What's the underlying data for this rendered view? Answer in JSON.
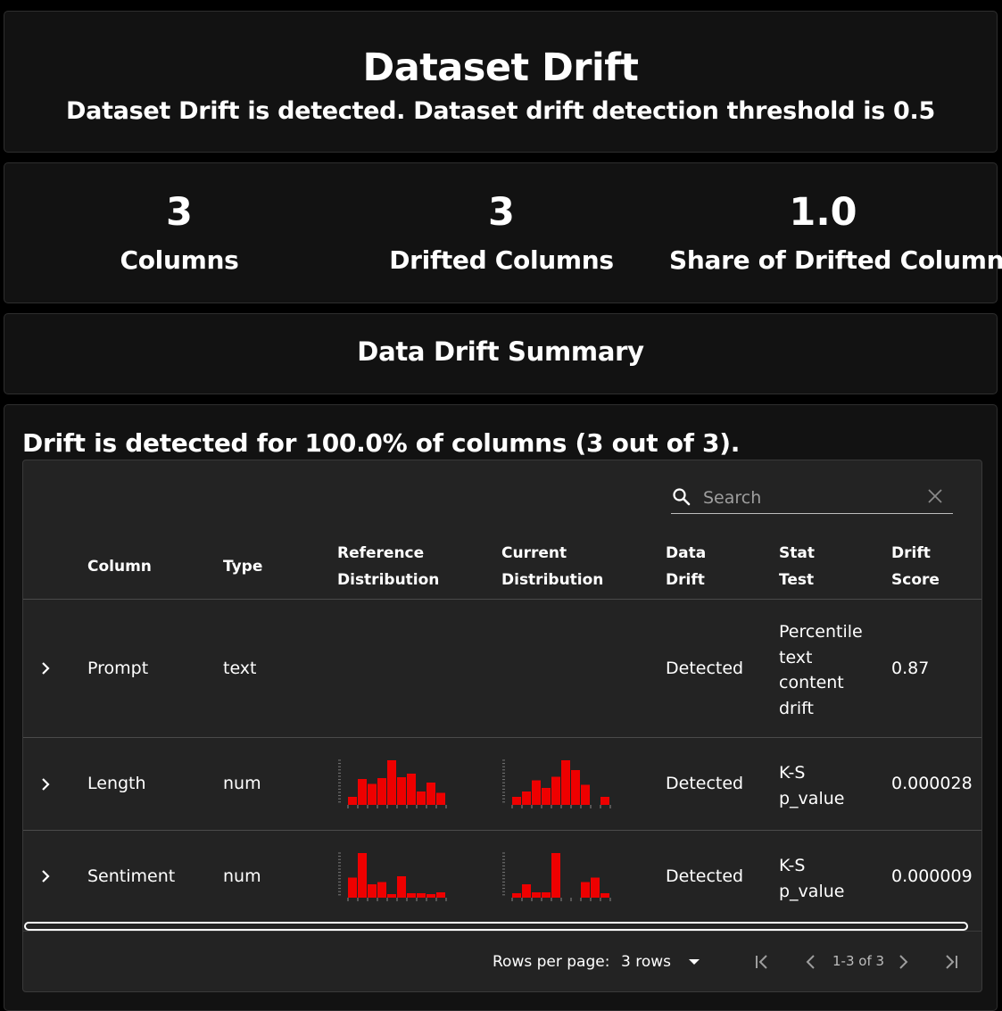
{
  "header": {
    "title": "Dataset Drift",
    "subtitle": "Dataset Drift is detected. Dataset drift detection threshold is 0.5"
  },
  "counters": [
    {
      "value": "3",
      "label": "Columns"
    },
    {
      "value": "3",
      "label": "Drifted Columns"
    },
    {
      "value": "1.0",
      "label": "Share of Drifted Columns"
    }
  ],
  "summary": {
    "title": "Data Drift Summary"
  },
  "table": {
    "message": "Drift is detected for 100.0% of columns (3 out of 3).",
    "search_placeholder": "Search",
    "headers": {
      "column": "Column",
      "type": "Type",
      "ref_1": "Reference",
      "ref_2": "Distribution",
      "cur_1": "Current",
      "cur_2": "Distribution",
      "drift_1": "Data",
      "drift_2": "Drift",
      "stat_1": "Stat",
      "stat_2": "Test",
      "score_1": "Drift",
      "score_2": "Score"
    },
    "rows": [
      {
        "column": "Prompt",
        "type": "text",
        "drift": "Detected",
        "stat": [
          "Percentile",
          "text",
          "content",
          "drift"
        ],
        "score": "0.87",
        "ref_hist": [],
        "cur_hist": []
      },
      {
        "column": "Length",
        "type": "num",
        "drift": "Detected",
        "stat": [
          "K-S",
          "p_value"
        ],
        "score": "0.000028",
        "ref_hist": [
          0.18,
          0.58,
          0.47,
          0.6,
          1.0,
          0.62,
          0.7,
          0.3,
          0.5,
          0.27
        ],
        "cur_hist": [
          0.18,
          0.3,
          0.55,
          0.38,
          0.63,
          1.0,
          0.78,
          0.45,
          0,
          0.18
        ]
      },
      {
        "column": "Sentiment",
        "type": "num",
        "drift": "Detected",
        "stat": [
          "K-S",
          "p_value"
        ],
        "score": "0.000009",
        "ref_hist": [
          0.45,
          1.0,
          0.3,
          0.35,
          0.08,
          0.48,
          0.1,
          0.1,
          0.08,
          0.12
        ],
        "cur_hist": [
          0.1,
          0.3,
          0.12,
          0.12,
          1.0,
          0,
          0,
          0.35,
          0.45,
          0.1
        ]
      }
    ],
    "pagination": {
      "rows_per_page_label": "Rows per page:",
      "rows_per_page_value": "3 rows",
      "range": "1-3 of 3"
    },
    "bar_color": "#ee0000"
  }
}
